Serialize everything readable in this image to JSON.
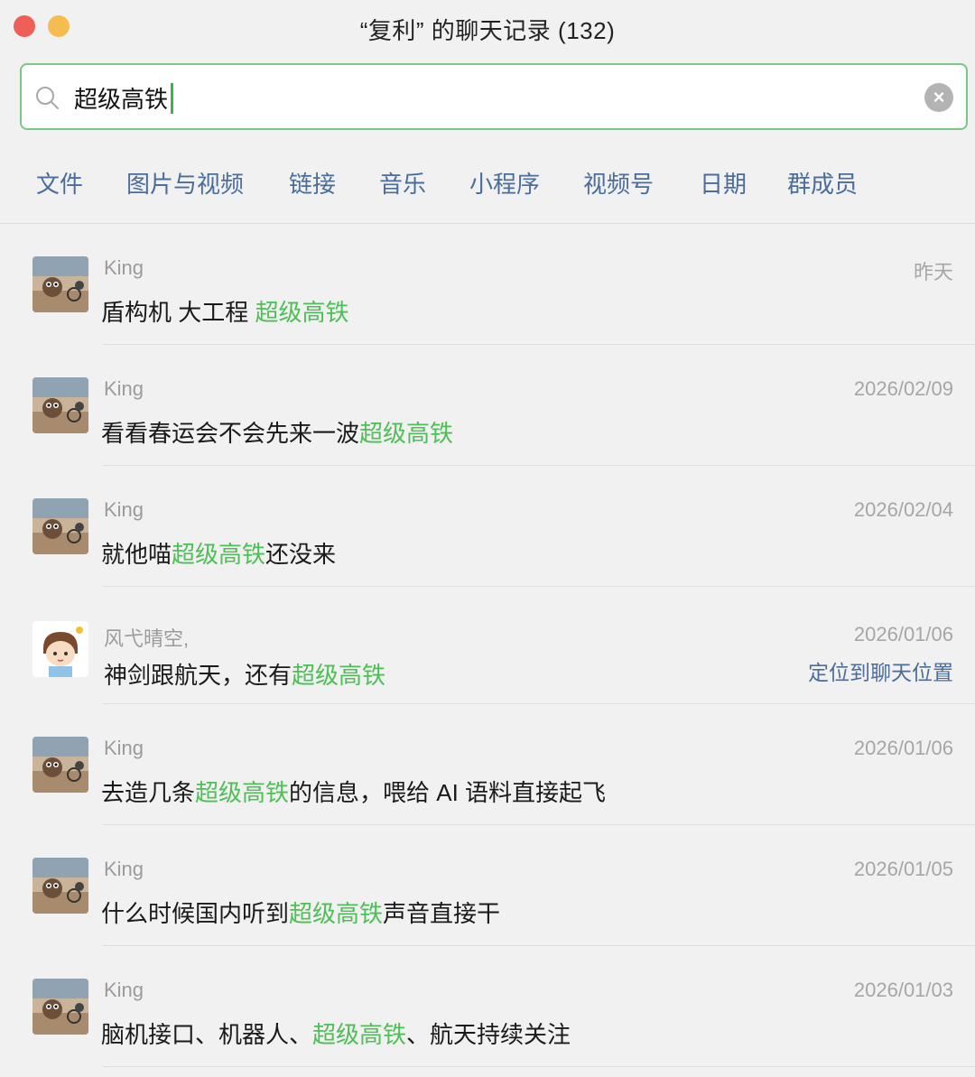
{
  "window": {
    "title": "“复利” 的聊天记录 (132)"
  },
  "search": {
    "value": "超级高铁"
  },
  "filters": [
    "文件",
    "图片与视频",
    "链接",
    "音乐",
    "小程序",
    "视频号",
    "日期",
    "群成员"
  ],
  "highlight_color": "#4cbf55",
  "results": [
    {
      "avatar": "king-avatar",
      "sender": "King",
      "date": "昨天",
      "before": "盾构机 大工程 ",
      "match": "超级高铁",
      "after": ""
    },
    {
      "avatar": "king-avatar",
      "sender": "King",
      "date": "2026/02/09",
      "before": "看看春运会不会先来一波",
      "match": "超级高铁",
      "after": ""
    },
    {
      "avatar": "king-avatar",
      "sender": "King",
      "date": "2026/02/04",
      "before": "就他喵",
      "match": "超级高铁",
      "after": "还没来"
    },
    {
      "avatar": "fengyi-avatar",
      "sender": "风弋晴空,",
      "date": "2026/01/06",
      "before": "神剑跟航天，还有",
      "match": "超级高铁",
      "after": "",
      "locate": "定位到聊天位置"
    },
    {
      "avatar": "king-avatar",
      "sender": "King",
      "date": "2026/01/06",
      "before": "去造几条",
      "match": "超级高铁",
      "after": "的信息，喂给 AI 语料直接起飞"
    },
    {
      "avatar": "king-avatar",
      "sender": "King",
      "date": "2026/01/05",
      "before": "什么时候国内听到",
      "match": "超级高铁",
      "after": "声音直接干"
    },
    {
      "avatar": "king-avatar",
      "sender": "King",
      "date": "2026/01/03",
      "before": "脑机接口、机器人、",
      "match": "超级高铁",
      "after": "、航天持续关注"
    }
  ]
}
